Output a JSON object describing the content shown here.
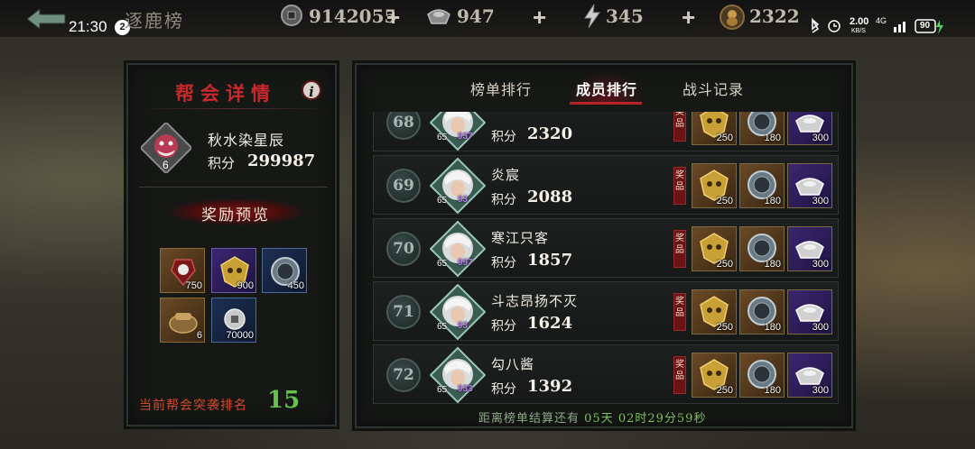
{
  "status_bar": {
    "time": "21:30",
    "notification_count": "2",
    "network_speed": "2.00",
    "network_speed_unit": "KB/S",
    "network_type": "4G",
    "battery": "90"
  },
  "header": {
    "title": "逐鹿榜",
    "resources": [
      {
        "icon": "coin-icon",
        "value": "9142055"
      },
      {
        "icon": "silver-ingot-icon",
        "value": "947"
      },
      {
        "icon": "lightning-icon",
        "value": "345"
      },
      {
        "icon": "gourd-icon",
        "value": "2322"
      }
    ]
  },
  "guild_panel": {
    "title": "帮会详情",
    "guild_name": "秋水染星辰",
    "guild_level": "6",
    "score_label": "积分",
    "score": "299987",
    "reward_preview_label": "奖励预览",
    "rewards": [
      {
        "icon": "jade-pendant-icon",
        "count": "750",
        "quality": "gold"
      },
      {
        "icon": "golden-mask-icon",
        "count": "900",
        "quality": "purple"
      },
      {
        "icon": "silver-orb-icon",
        "count": "450",
        "quality": "blue"
      },
      {
        "icon": "scroll-pouch-icon",
        "count": "6",
        "quality": "gold"
      },
      {
        "icon": "coin-icon",
        "count": "70000",
        "quality": "blue"
      }
    ],
    "rank_label": "当前帮会突袭排名",
    "rank_value": "15"
  },
  "tabs": [
    {
      "label": "榜单排行",
      "active": false
    },
    {
      "label": "成员排行",
      "active": true
    },
    {
      "label": "战斗记录",
      "active": false
    }
  ],
  "members": [
    {
      "rank": "68",
      "name": "",
      "level": "65",
      "tag": "937",
      "score_label": "积分",
      "score": "2320",
      "reward_tag": "奖品",
      "rewards": [
        {
          "icon": "golden-mask-icon",
          "count": "250"
        },
        {
          "icon": "silver-orb-icon",
          "count": "180"
        },
        {
          "icon": "silver-ingot-icon",
          "count": "300"
        }
      ]
    },
    {
      "rank": "69",
      "name": "炎宸",
      "level": "65",
      "tag": "93",
      "score_label": "积分",
      "score": "2088",
      "reward_tag": "奖品",
      "rewards": [
        {
          "icon": "golden-mask-icon",
          "count": "250"
        },
        {
          "icon": "silver-orb-icon",
          "count": "180"
        },
        {
          "icon": "silver-ingot-icon",
          "count": "300"
        }
      ]
    },
    {
      "rank": "70",
      "name": "寒江只客",
      "level": "65",
      "tag": "997",
      "score_label": "积分",
      "score": "1857",
      "reward_tag": "奖品",
      "rewards": [
        {
          "icon": "golden-mask-icon",
          "count": "250"
        },
        {
          "icon": "silver-orb-icon",
          "count": "180"
        },
        {
          "icon": "silver-ingot-icon",
          "count": "300"
        }
      ]
    },
    {
      "rank": "71",
      "name": "斗志昂扬不灭",
      "level": "65",
      "tag": "93",
      "score_label": "积分",
      "score": "1624",
      "reward_tag": "奖品",
      "rewards": [
        {
          "icon": "golden-mask-icon",
          "count": "250"
        },
        {
          "icon": "silver-orb-icon",
          "count": "180"
        },
        {
          "icon": "silver-ingot-icon",
          "count": "300"
        }
      ]
    },
    {
      "rank": "72",
      "name": "勾八酱",
      "level": "65",
      "tag": "933",
      "score_label": "积分",
      "score": "1392",
      "reward_tag": "奖品",
      "rewards": [
        {
          "icon": "golden-mask-icon",
          "count": "250"
        },
        {
          "icon": "silver-orb-icon",
          "count": "180"
        },
        {
          "icon": "silver-ingot-icon",
          "count": "300"
        }
      ]
    }
  ],
  "countdown": {
    "label": "距离榜单结算还有",
    "time": "05天 02时29分59秒"
  }
}
